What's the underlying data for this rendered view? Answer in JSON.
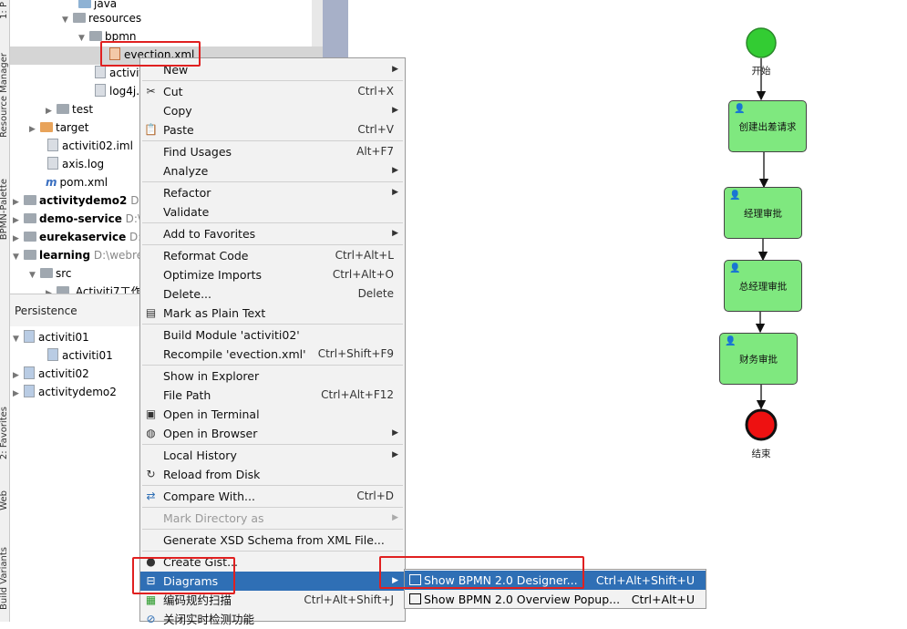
{
  "left_strip": {
    "labels": [
      "1: P",
      "Resource Manager",
      "BPMN-Palette",
      "2: Favorites",
      "Web",
      "Build Variants"
    ]
  },
  "tree": {
    "rows": [
      {
        "text": "java",
        "indent": 0
      },
      {
        "text": "resources",
        "indent": 0
      },
      {
        "text": "bpmn",
        "indent": 0
      },
      {
        "text": "evection.xml",
        "indent": 0
      },
      {
        "text": "activit",
        "indent": 0
      },
      {
        "text": "log4j.",
        "indent": 0
      },
      {
        "text": "test",
        "indent": 0
      },
      {
        "text": "target",
        "indent": 0
      },
      {
        "text": "activiti02.iml",
        "indent": 0
      },
      {
        "text": "axis.log",
        "indent": 0
      },
      {
        "text": "pom.xml",
        "indent": 0
      },
      {
        "text": "activitydemo2",
        "path": "D:"
      },
      {
        "text": "demo-service",
        "path": "D:\\"
      },
      {
        "text": "eurekaservice",
        "path": "D:\\"
      },
      {
        "text": "learning",
        "path": "D:\\webre"
      },
      {
        "text": "src",
        "indent": 0
      },
      {
        "text": ".Activiti7工作",
        "indent": 0
      }
    ]
  },
  "persistence": {
    "title": "Persistence",
    "items": [
      "activiti01",
      "activiti01",
      "activiti02",
      "activitydemo2"
    ]
  },
  "context_menu": {
    "items": [
      {
        "label": "New",
        "shortcut": "",
        "submenu": true
      },
      {
        "label": "Cut",
        "shortcut": "Ctrl+X",
        "icon": "scissors-icon"
      },
      {
        "label": "Copy",
        "shortcut": "",
        "submenu": true
      },
      {
        "label": "Paste",
        "shortcut": "Ctrl+V",
        "icon": "clipboard-icon"
      },
      {
        "label": "Find Usages",
        "shortcut": "Alt+F7"
      },
      {
        "label": "Analyze",
        "shortcut": "",
        "submenu": true
      },
      {
        "label": "Refactor",
        "shortcut": "",
        "submenu": true
      },
      {
        "label": "Validate",
        "shortcut": ""
      },
      {
        "label": "Add to Favorites",
        "shortcut": "",
        "submenu": true
      },
      {
        "label": "Reformat Code",
        "shortcut": "Ctrl+Alt+L"
      },
      {
        "label": "Optimize Imports",
        "shortcut": "Ctrl+Alt+O"
      },
      {
        "label": "Delete...",
        "shortcut": "Delete"
      },
      {
        "label": "Mark as Plain Text",
        "shortcut": "",
        "icon": "plain-text-icon"
      },
      {
        "label": "Build Module 'activiti02'",
        "shortcut": ""
      },
      {
        "label": "Recompile 'evection.xml'",
        "shortcut": "Ctrl+Shift+F9"
      },
      {
        "label": "Show in Explorer",
        "shortcut": ""
      },
      {
        "label": "File Path",
        "shortcut": "Ctrl+Alt+F12"
      },
      {
        "label": "Open in Terminal",
        "shortcut": "",
        "icon": "terminal-icon"
      },
      {
        "label": "Open in Browser",
        "shortcut": "",
        "icon": "globe-icon",
        "submenu": true
      },
      {
        "label": "Local History",
        "shortcut": "",
        "submenu": true
      },
      {
        "label": "Reload from Disk",
        "shortcut": "",
        "icon": "reload-icon"
      },
      {
        "label": "Compare With...",
        "shortcut": "Ctrl+D",
        "icon": "compare-icon"
      },
      {
        "label": "Mark Directory as",
        "shortcut": "",
        "submenu": true,
        "disabled": true
      },
      {
        "label": "Generate XSD Schema from XML File...",
        "shortcut": ""
      },
      {
        "label": "Create Gist...",
        "shortcut": "",
        "icon": "github-icon"
      },
      {
        "label": "Diagrams",
        "shortcut": "",
        "icon": "diagram-icon",
        "submenu": true,
        "active": true
      },
      {
        "label": "编码规约扫描",
        "shortcut": "Ctrl+Alt+Shift+J",
        "icon": "scan-icon"
      },
      {
        "label": "关闭实时检测功能",
        "shortcut": "",
        "icon": "forbid-icon"
      }
    ]
  },
  "submenu": {
    "items": [
      {
        "label": "Show BPMN 2.0 Designer...",
        "shortcut": "Ctrl+Alt+Shift+U",
        "active": true
      },
      {
        "label": "Show BPMN 2.0 Overview Popup...",
        "shortcut": "Ctrl+Alt+U"
      }
    ]
  },
  "diagram": {
    "start_label": "开始",
    "end_label": "结束",
    "tasks": [
      "创建出差请求",
      "经理审批",
      "总经理审批",
      "财务审批"
    ],
    "colors": {
      "start": "#33cc33",
      "end": "#ee1111",
      "task": "#7fe87f",
      "highlight": "#e02020",
      "menu_active": "#2f6fb5"
    }
  }
}
